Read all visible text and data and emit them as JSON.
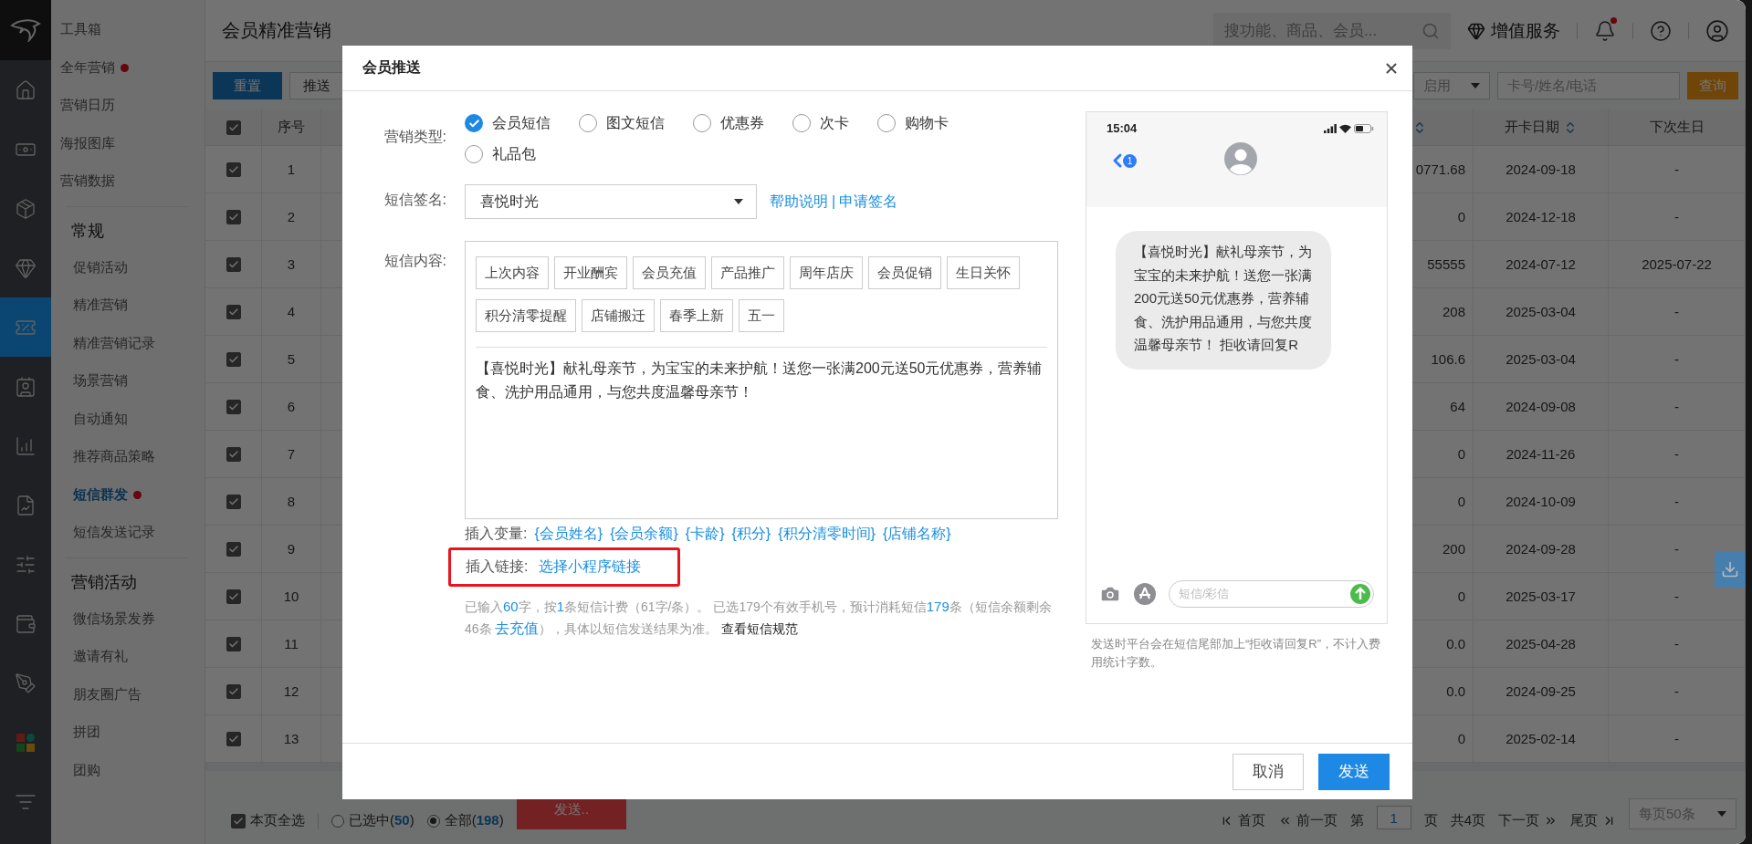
{
  "rail": {
    "items": [
      {
        "kind": "home",
        "selected": false
      },
      {
        "kind": "cash",
        "selected": false
      },
      {
        "kind": "box",
        "selected": false
      },
      {
        "kind": "gem",
        "selected": false
      },
      {
        "kind": "coupon",
        "selected": true
      },
      {
        "kind": "card",
        "selected": false
      },
      {
        "kind": "chart",
        "selected": false
      },
      {
        "kind": "report",
        "selected": false
      },
      {
        "kind": "sliders",
        "selected": false
      },
      {
        "kind": "wallet",
        "selected": false
      },
      {
        "kind": "tools",
        "selected": false
      },
      {
        "kind": "tiles",
        "selected": false
      },
      {
        "kind": "search-list",
        "selected": false
      }
    ]
  },
  "sidebar": {
    "groups": [
      {
        "items": [
          {
            "label": "工具箱",
            "selected": false,
            "dot": false
          },
          {
            "label": "全年营销",
            "selected": false,
            "dot": true
          },
          {
            "label": "营销日历",
            "selected": false,
            "dot": false
          },
          {
            "label": "海报图库",
            "selected": false,
            "dot": false
          },
          {
            "label": "营销数据",
            "selected": false,
            "dot": false
          }
        ]
      },
      {
        "heading": "常规",
        "items": [
          {
            "label": "促销活动",
            "selected": false,
            "dot": false
          },
          {
            "label": "精准营销",
            "selected": false,
            "dot": false
          },
          {
            "label": "精准营销记录",
            "selected": false,
            "dot": false
          },
          {
            "label": "场景营销",
            "selected": false,
            "dot": false
          },
          {
            "label": "自动通知",
            "selected": false,
            "dot": false
          },
          {
            "label": "推荐商品策略",
            "selected": false,
            "dot": false
          },
          {
            "label": "短信群发",
            "selected": true,
            "dot": true
          },
          {
            "label": "短信发送记录",
            "selected": false,
            "dot": false
          }
        ]
      },
      {
        "heading": "营销活动",
        "items": [
          {
            "label": "微信场景发券",
            "selected": false,
            "dot": false
          },
          {
            "label": "邀请有礼",
            "selected": false,
            "dot": false
          },
          {
            "label": "朋友圈广告",
            "selected": false,
            "dot": false
          },
          {
            "label": "拼团",
            "selected": false,
            "dot": false
          },
          {
            "label": "团购",
            "selected": false,
            "dot": false
          }
        ]
      }
    ]
  },
  "header": {
    "title": "会员精准营销",
    "search": {
      "placeholder": "搜功能、商品、会员..."
    },
    "service": "增值服务",
    "notification_dot": true
  },
  "toolbar": {
    "reset": "重置",
    "push": "推送",
    "status": "启用",
    "search": {
      "placeholder": "卡号/姓名/电话"
    },
    "query": "查询"
  },
  "table": {
    "all_checked": true,
    "columns": [
      "序号",
      "开卡日期",
      "下次生日"
    ],
    "rows": [
      {
        "checked": true,
        "index": "1",
        "column_3": "0771.68",
        "open_date": "2024-09-18",
        "next_birthday": "-"
      },
      {
        "checked": true,
        "index": "2",
        "column_3": "0",
        "open_date": "2024-12-18",
        "next_birthday": "-"
      },
      {
        "checked": true,
        "index": "3",
        "column_3": "55555",
        "open_date": "2024-07-12",
        "next_birthday": "2025-07-22"
      },
      {
        "checked": true,
        "index": "4",
        "column_3": "208",
        "open_date": "2025-03-04",
        "next_birthday": "-"
      },
      {
        "checked": true,
        "index": "5",
        "column_3": "106.6",
        "open_date": "2025-03-04",
        "next_birthday": "-"
      },
      {
        "checked": true,
        "index": "6",
        "column_3": "64",
        "open_date": "2024-09-08",
        "next_birthday": "-"
      },
      {
        "checked": true,
        "index": "7",
        "column_3": "0",
        "open_date": "2024-11-26",
        "next_birthday": "-"
      },
      {
        "checked": true,
        "index": "8",
        "column_3": "0",
        "open_date": "2024-10-09",
        "next_birthday": "-"
      },
      {
        "checked": true,
        "index": "9",
        "column_3": "200",
        "open_date": "2024-09-28",
        "next_birthday": "-"
      },
      {
        "checked": true,
        "index": "10",
        "column_3": "0",
        "open_date": "2025-03-17",
        "next_birthday": "-"
      },
      {
        "checked": true,
        "index": "11",
        "column_3": "0.0",
        "open_date": "2025-04-28",
        "next_birthday": "-"
      },
      {
        "checked": true,
        "index": "12",
        "column_3": "0.0",
        "open_date": "2024-09-25",
        "next_birthday": "-"
      },
      {
        "checked": true,
        "index": "13",
        "column_3": "0",
        "open_date": "2025-02-14",
        "next_birthday": "-"
      }
    ]
  },
  "bottom_bar": {
    "select_page": {
      "label": "本页全选",
      "checked": true
    },
    "scope": [
      {
        "label": "已选中(",
        "count": "50",
        "suffix": ")",
        "selected": false
      },
      {
        "label": "全部(",
        "count": "198",
        "suffix": ")",
        "selected": true
      }
    ],
    "send": "发送..",
    "pagination": {
      "first": "首页",
      "prev": "前一页",
      "page_prefix": "第",
      "page": "1",
      "page_suffix": "页",
      "total": "共4页",
      "next": "下一页",
      "last": "尾页",
      "page_size": "每页50条"
    }
  },
  "modal": {
    "title": "会员推送",
    "type_label": "营销类型:",
    "types": [
      {
        "label": "会员短信",
        "selected": true
      },
      {
        "label": "图文短信",
        "selected": false
      },
      {
        "label": "优惠券",
        "selected": false
      },
      {
        "label": "次卡",
        "selected": false
      },
      {
        "label": "购物卡",
        "selected": false
      },
      {
        "label": "礼品包",
        "selected": false
      }
    ],
    "signature": {
      "label": "短信签名:",
      "value": "喜悦时光",
      "help": "帮助说明",
      "separator": "|",
      "apply": "申请签名"
    },
    "content_label": "短信内容:",
    "templates": [
      "上次内容",
      "开业酬宾",
      "会员充值",
      "产品推广",
      "周年店庆",
      "会员促销",
      "生日关怀",
      "积分清零提醒",
      "店铺搬迁",
      "春季上新",
      "五一"
    ],
    "message": "【喜悦时光】献礼母亲节，为宝宝的未来护航！送您一张满200元送50元优惠券，营养辅食、洗护用品通用，与您共度温馨母亲节！",
    "variables": {
      "label": "插入变量:",
      "items": [
        "{会员姓名}",
        "{会员余额}",
        "{卡龄}",
        "{积分}",
        "{积分清零时间}",
        "{店铺名称}"
      ]
    },
    "link_row": {
      "label": "插入链接:",
      "link": "选择小程序链接",
      "highlighted": true
    },
    "note": [
      {
        "kind": "text",
        "text": "已输入"
      },
      {
        "kind": "number",
        "text": "60"
      },
      {
        "kind": "text",
        "text": "字，按"
      },
      {
        "kind": "number",
        "text": "1"
      },
      {
        "kind": "text",
        "text": "条短信计费（61字/条）。 已选179个有效手机号，预计消耗短信"
      },
      {
        "kind": "number",
        "text": "179"
      },
      {
        "kind": "text",
        "text": "条（短信余额剩余46条 "
      },
      {
        "kind": "link",
        "text": "去充值"
      },
      {
        "kind": "text",
        "text": "），具体以短信发送结果为准。 "
      },
      {
        "kind": "rule",
        "text": "查看短信规范"
      }
    ],
    "preview": {
      "time": "15:04",
      "back_badge": "1",
      "bubble": "【喜悦时光】献礼母亲节，为宝宝的未来护航！送您一张满200元送50元优惠券，营养辅食、洗护用品通用，与您共度温馨母亲节！ 拒收请回复R",
      "input_placeholder": "短信/彩信",
      "note": "发送时平台会在短信尾部加上“拒收请回复R”，不计入费用统计字数。"
    },
    "buttons": [
      {
        "label": "取消",
        "kind": "secondary"
      },
      {
        "label": "发送",
        "kind": "primary"
      }
    ]
  }
}
